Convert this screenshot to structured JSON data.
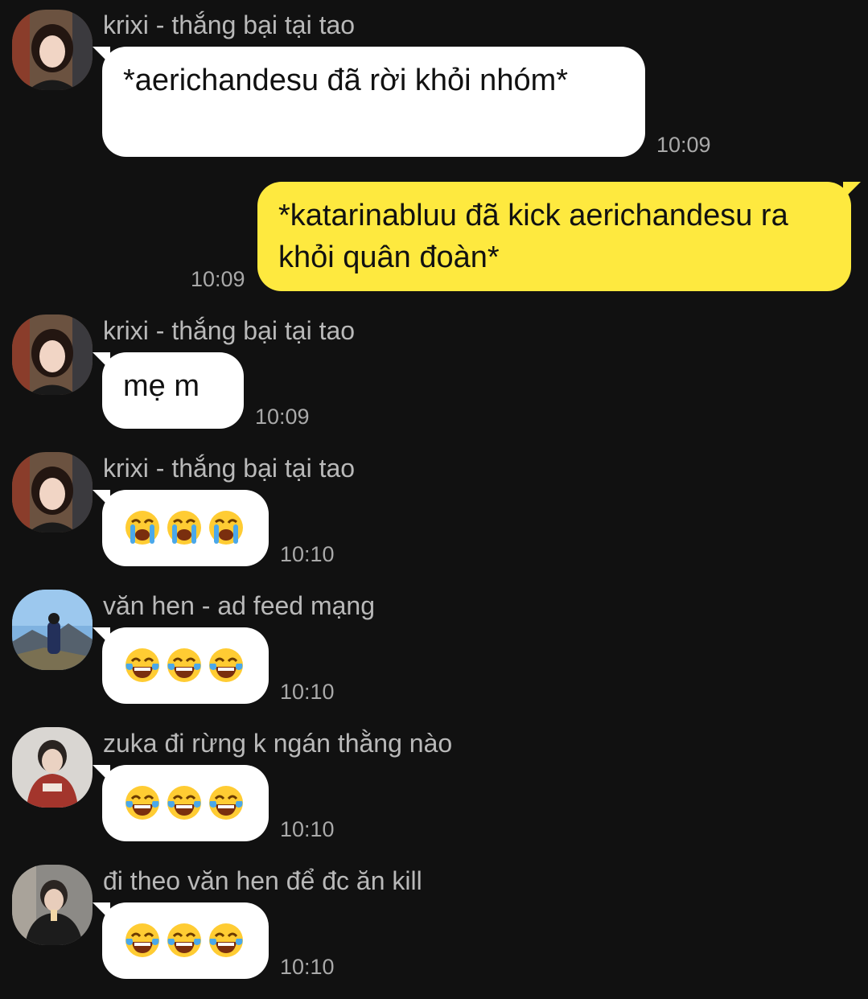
{
  "messages": [
    {
      "sender": "krixi - thắng bại tại tao",
      "avatar": "avatar-krixi",
      "text": "*aerichandesu đã rời khỏi nhóm*",
      "time": "10:09"
    },
    {
      "sender": "",
      "outgoing": true,
      "text": "*katarinabluu đã kick aerichandesu ra khỏi quân đoàn*",
      "time": "10:09"
    },
    {
      "sender": "krixi - thắng bại tại tao",
      "avatar": "avatar-krixi",
      "text": "mẹ m",
      "time": "10:09"
    },
    {
      "sender": "krixi - thắng bại tại tao",
      "avatar": "avatar-krixi",
      "emoji": [
        "loudly-crying-face",
        "loudly-crying-face",
        "loudly-crying-face"
      ],
      "time": "10:10"
    },
    {
      "sender": "văn hen - ad feed mạng",
      "avatar": "avatar-van-hen",
      "emoji": [
        "face-with-tears-of-joy",
        "face-with-tears-of-joy",
        "face-with-tears-of-joy"
      ],
      "time": "10:10"
    },
    {
      "sender": "zuka đi rừng k ngán thằng nào",
      "avatar": "avatar-zuka",
      "emoji": [
        "face-with-tears-of-joy",
        "face-with-tears-of-joy",
        "face-with-tears-of-joy"
      ],
      "time": "10:10"
    },
    {
      "sender": "đi theo văn hen để đc ăn kill",
      "avatar": "avatar-di-theo",
      "emoji": [
        "face-with-tears-of-joy",
        "face-with-tears-of-joy",
        "face-with-tears-of-joy"
      ],
      "time": "10:10"
    }
  ],
  "colors": {
    "background": "#111111",
    "incoming_bubble": "#ffffff",
    "outgoing_bubble": "#fee93f",
    "sender_name": "#b9b9b9",
    "timestamp": "#a9a9a9"
  }
}
